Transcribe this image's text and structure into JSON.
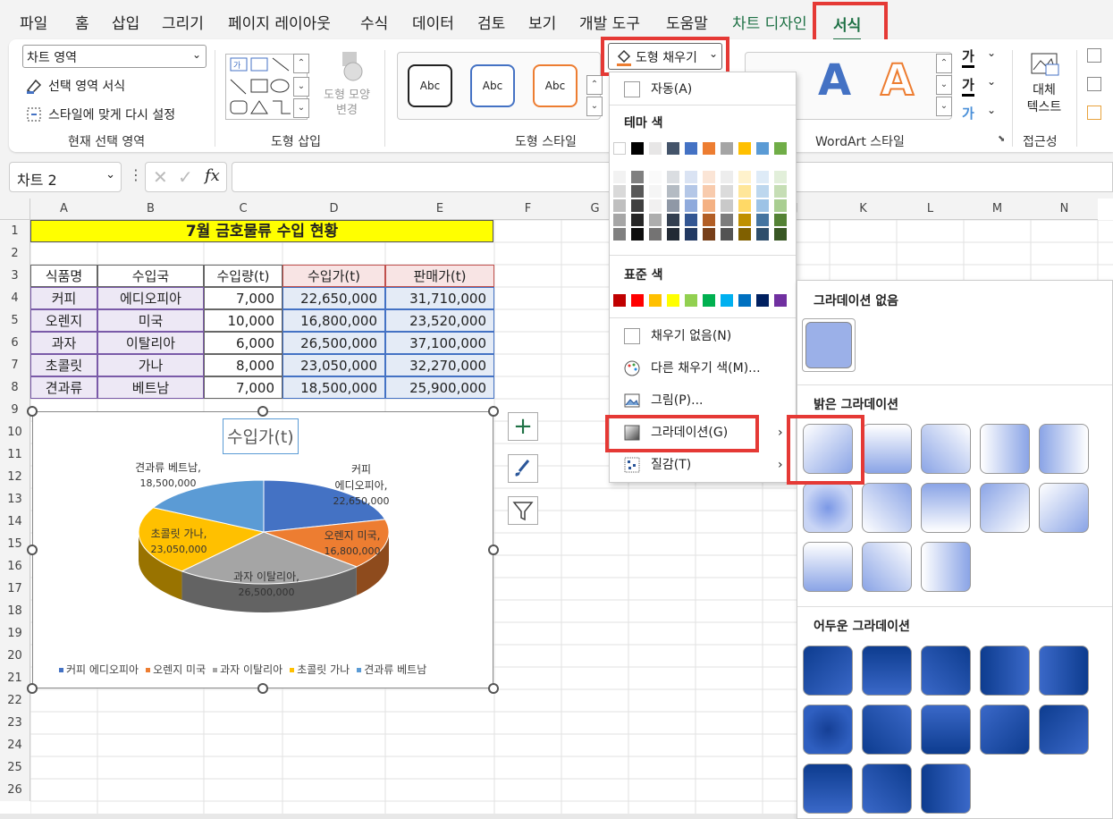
{
  "tabs": [
    "파일",
    "홈",
    "삽입",
    "그리기",
    "페이지 레이아웃",
    "수식",
    "데이터",
    "검토",
    "보기",
    "개발 도구",
    "도움말",
    "차트 디자인",
    "서식"
  ],
  "ribbon": {
    "current_selection": {
      "dropdown": "차트 영역",
      "format_selection": "선택 영역 서식",
      "reset_style": "스타일에 맞게 다시 설정",
      "group": "현재 선택 영역"
    },
    "insert_shapes": {
      "change_shape": "도형 모양 변경",
      "group": "도형 삽입"
    },
    "shape_styles": {
      "samples": [
        "Abc",
        "Abc",
        "Abc"
      ],
      "fill_button": "도형 채우기",
      "group": "도형 스타일"
    },
    "wordart": {
      "letters": [
        "A",
        "A"
      ],
      "group": "WordArt 스타일",
      "text_icons": [
        "가",
        "가",
        "가"
      ]
    },
    "accessibility": {
      "alt_text": "대체 텍스트",
      "group": "접근성"
    }
  },
  "namebox": "차트 2",
  "fx": "fx",
  "columns": [
    "A",
    "B",
    "C",
    "D",
    "E",
    "F",
    "G",
    "H",
    "I",
    "J",
    "K",
    "L",
    "M",
    "N"
  ],
  "rows": [
    "1",
    "2",
    "3",
    "4",
    "5",
    "6",
    "7",
    "8",
    "9",
    "10",
    "11",
    "12",
    "13",
    "14",
    "15",
    "16",
    "17",
    "18",
    "19",
    "20",
    "21",
    "22",
    "23",
    "24",
    "25",
    "26"
  ],
  "table": {
    "title": "7월 금호물류 수입 현황",
    "headers": [
      "식품명",
      "수입국",
      "수입량(t)",
      "수입가(t)",
      "판매가(t)"
    ],
    "rows": [
      [
        "커피",
        "에디오피아",
        "7,000",
        "22,650,000",
        "31,710,000"
      ],
      [
        "오렌지",
        "미국",
        "10,000",
        "16,800,000",
        "23,520,000"
      ],
      [
        "과자",
        "이탈리아",
        "6,000",
        "26,500,000",
        "37,100,000"
      ],
      [
        "초콜릿",
        "가나",
        "8,000",
        "23,050,000",
        "32,270,000"
      ],
      [
        "견과류",
        "베트남",
        "7,000",
        "18,500,000",
        "25,900,000"
      ]
    ]
  },
  "chart_data": {
    "type": "pie",
    "title": "수입가(t)",
    "categories": [
      "커피 에디오피아",
      "오렌지 미국",
      "과자 이탈리아",
      "초콜릿 가나",
      "견과류 베트남"
    ],
    "values": [
      22650000,
      16800000,
      26500000,
      23050000,
      18500000
    ],
    "data_labels": [
      {
        "name": "커피 에디오피아,",
        "value": "22,650,000"
      },
      {
        "name": "오렌지 미국,",
        "value": "16,800,000"
      },
      {
        "name": "과자 이탈리아,",
        "value": "26,500,000"
      },
      {
        "name": "초콜릿 가나,",
        "value": "23,050,000"
      },
      {
        "name": "견과류 베트남,",
        "value": "18,500,000"
      }
    ],
    "colors": [
      "#4472c4",
      "#ed7d31",
      "#a5a5a5",
      "#ffc000",
      "#5b9bd5"
    ],
    "legend_position": "bottom"
  },
  "fill_menu": {
    "auto": "자동(A)",
    "theme_header": "테마 색",
    "standard_header": "표준 색",
    "no_fill": "채우기 없음(N)",
    "more_colors": "다른 채우기 색(M)...",
    "picture": "그림(P)...",
    "gradient": "그라데이션(G)",
    "texture": "질감(T)",
    "theme_colors": [
      "#ffffff",
      "#000000",
      "#e7e6e6",
      "#44546a",
      "#4472c4",
      "#ed7d31",
      "#a5a5a5",
      "#ffc000",
      "#5b9bd5",
      "#70ad47"
    ],
    "standard_colors": [
      "#c00000",
      "#ff0000",
      "#ffc000",
      "#ffff00",
      "#92d050",
      "#00b050",
      "#00b0f0",
      "#0070c0",
      "#002060",
      "#7030a0"
    ]
  },
  "gradient_menu": {
    "none_header": "그라데이션 없음",
    "light_header": "밝은 그라데이션",
    "dark_header": "어두운 그라데이션"
  }
}
